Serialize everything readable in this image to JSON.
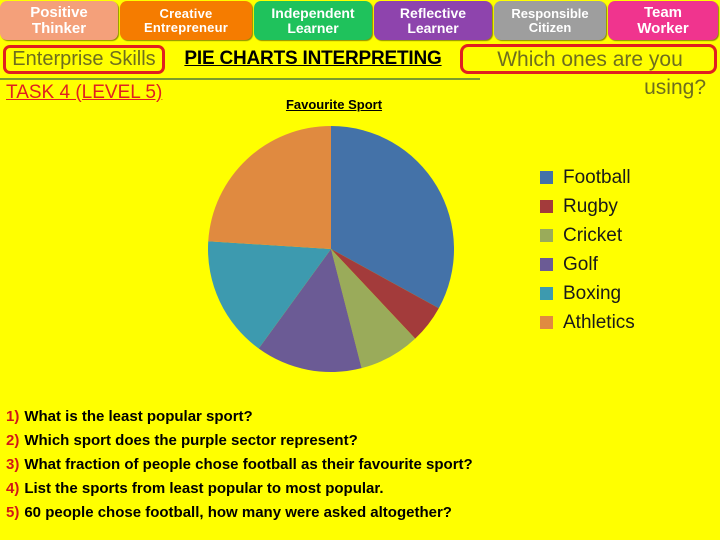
{
  "banners": [
    {
      "line1": "Positive",
      "line2": "Thinker",
      "color": "#F4A07A",
      "key": "positive-thinker"
    },
    {
      "line1": "Creative",
      "line2": "Entrepreneur",
      "color": "#F57C00",
      "key": "creative-entrepreneur"
    },
    {
      "line1": "Independent",
      "line2": "Learner",
      "color": "#1FC25C",
      "key": "independent-learner"
    },
    {
      "line1": "Reflective",
      "line2": "Learner",
      "color": "#8E44AD",
      "key": "reflective-learner"
    },
    {
      "line1": "Responsible",
      "line2": "Citizen",
      "color": "#9E9E9E",
      "key": "responsible-citizen"
    },
    {
      "line1": "Team",
      "line2": "Worker",
      "color": "#F0348E",
      "key": "team-worker"
    }
  ],
  "header": {
    "enterprise_skills": "Enterprise Skills",
    "title": "PIE CHARTS INTERPRETING",
    "prompt_line1": "Which ones are you",
    "prompt_line2": "using?",
    "task_label": "TASK 4 (LEVEL 5)",
    "accent_red": "#E02020",
    "olive_text": "#6E6E1E"
  },
  "chart_data": {
    "type": "pie",
    "title": "Favourite Sport",
    "categories": [
      "Football",
      "Rugby",
      "Cricket",
      "Golf",
      "Boxing",
      "Athletics"
    ],
    "values": [
      33,
      5,
      8,
      14,
      16,
      24
    ],
    "unit": "percent",
    "start_angle_deg": 0,
    "direction": "clockwise",
    "colors": [
      "#4472A8",
      "#A33B3B",
      "#9AAB5A",
      "#6B5B95",
      "#3D9AAF",
      "#E08A40"
    ],
    "legend_position": "right",
    "grid": false,
    "labels_shown": false
  },
  "questions": [
    {
      "num": "1)",
      "text": "What is the least popular sport?"
    },
    {
      "num": "2)",
      "text": "Which sport does the purple sector represent?"
    },
    {
      "num": "3)",
      "text": "What fraction of people chose football as their favourite sport?"
    },
    {
      "num": "4)",
      "text": "List the sports from least popular to most popular."
    },
    {
      "num": "5)",
      "text": "60 people chose football, how many were asked altogether?"
    }
  ]
}
